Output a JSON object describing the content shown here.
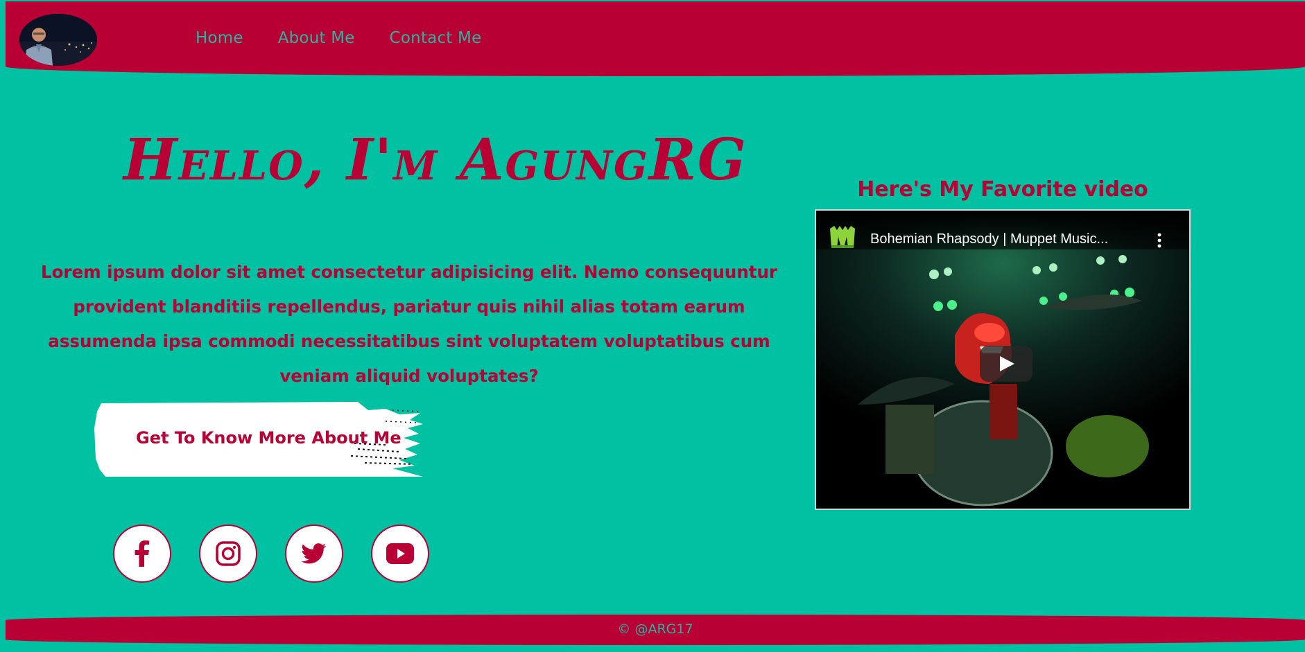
{
  "nav": {
    "items": [
      {
        "label": "Home"
      },
      {
        "label": "About Me"
      },
      {
        "label": "Contact Me"
      }
    ]
  },
  "hero": {
    "title": "Hello, I'm AgungRG",
    "paragraph": "Lorem ipsum dolor sit amet consectetur adipisicing elit. Nemo consequuntur provident blanditiis repellendus, pariatur quis nihil alias totam earum assumenda ipsa commodi necessitatibus sint voluptatem voluptatibus cum veniam aliquid voluptates?",
    "cta_label": "Get To Know More About Me"
  },
  "socials": [
    {
      "icon": "facebook-icon"
    },
    {
      "icon": "instagram-icon"
    },
    {
      "icon": "twitter-icon"
    },
    {
      "icon": "youtube-icon"
    }
  ],
  "video": {
    "heading": "Here's My Favorite video",
    "name": "Bohemian Rhapsody | Muppet Music..."
  },
  "footer": {
    "text": "© @ARG17"
  },
  "colors": {
    "background": "#00c2a2",
    "brand": "#b80034",
    "nav_text": "#29b5a0",
    "cta_bg": "#ffffff"
  }
}
